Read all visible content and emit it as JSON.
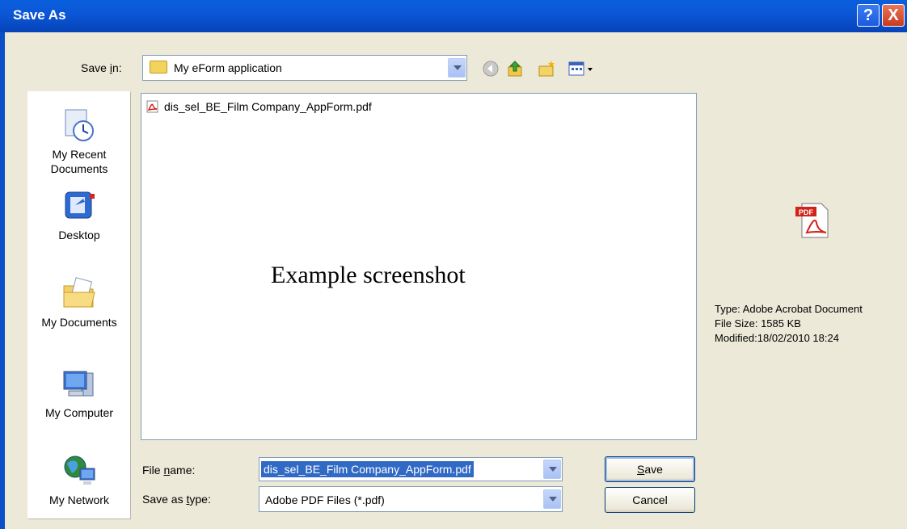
{
  "window": {
    "title": "Save As",
    "help_label": "?",
    "close_label": "X"
  },
  "save_in": {
    "label_pre": "Save ",
    "label_key": "i",
    "label_post": "n:",
    "value": "My eForm application"
  },
  "toolbar": {
    "icons": [
      "back-icon",
      "up-folder-icon",
      "new-folder-icon",
      "views-menu-icon"
    ]
  },
  "places": [
    {
      "label": "My Recent Documents",
      "icon": "recent-documents-icon"
    },
    {
      "label": "Desktop",
      "icon": "desktop-icon"
    },
    {
      "label": "My Documents",
      "icon": "my-documents-icon"
    },
    {
      "label": "My Computer",
      "icon": "my-computer-icon"
    },
    {
      "label": "My Network",
      "icon": "my-network-icon"
    }
  ],
  "files": [
    {
      "name": "dis_sel_BE_Film Company_AppForm.pdf",
      "icon": "pdf-file-icon"
    }
  ],
  "watermark": "Example screenshot",
  "preview": {
    "icon": "adobe-pdf-icon",
    "type": "Type: Adobe Acrobat Document",
    "size": "File Size: 1585 KB",
    "modified": "Modified:18/02/2010 18:24"
  },
  "file_name": {
    "label_pre": "File ",
    "label_key": "n",
    "label_post": "ame:",
    "value": "dis_sel_BE_Film Company_AppForm.pdf"
  },
  "save_as_type": {
    "label_pre": "Save as ",
    "label_key": "t",
    "label_post": "ype:",
    "value": "Adobe PDF Files (*.pdf)"
  },
  "buttons": {
    "save_key": "S",
    "save_rest": "ave",
    "cancel": "Cancel"
  },
  "colors": {
    "titlebar": "#0b56d6",
    "dialog_bg": "#ece9d8",
    "selection": "#316ac5"
  }
}
